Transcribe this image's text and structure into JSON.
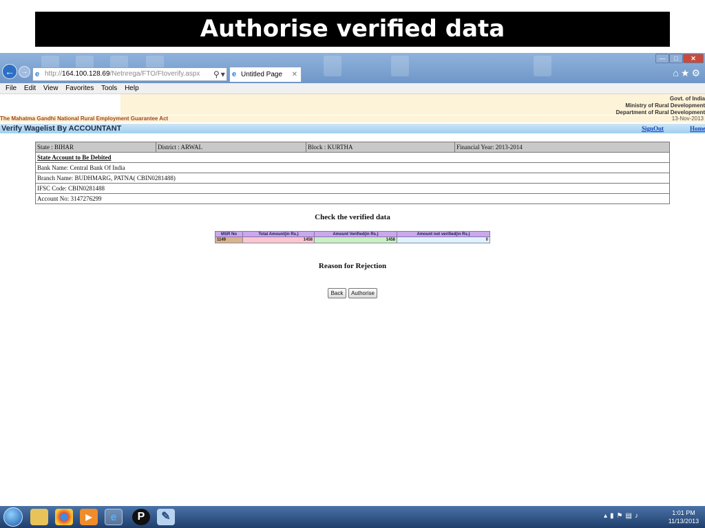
{
  "slide": {
    "title": "Authorise verified data"
  },
  "browser": {
    "url_protocol": "http://",
    "url_host": "164.100.128.69",
    "url_path": "/Netnrega/FTO/Ftoverify.aspx",
    "tab_title": "Untitled Page",
    "menu": [
      "File",
      "Edit",
      "View",
      "Favorites",
      "Tools",
      "Help"
    ]
  },
  "header": {
    "govt_line1": "Govt. of India",
    "govt_line2": "Ministry of Rural Development",
    "govt_line3": "Department of Rural Development",
    "act": "The Mahatma Gandhi National Rural Employment Guarantee Act",
    "date": "13-Nov-2013",
    "page_heading": "Verify Wagelist By ACCOUNTANT",
    "signout": "SignOut",
    "home": "Home"
  },
  "account": {
    "state": "State : BIHAR",
    "district": "District : ARWAL",
    "block": "Block : KURTHA",
    "financial_year": "Financial Year: 2013-2014",
    "section_heading": "State Account to Be Debited",
    "bank_name": "Bank Name: Central Bank Of India",
    "branch_name": "Branch Name: BUDHMARG, PATNA( CBIN0281488)",
    "ifsc": "IFSC Code: CBIN0281488",
    "account_no": "Account No: 3147276299"
  },
  "check": {
    "title": "Check the verified data",
    "headers": [
      "MSR No",
      "Total Amount(in Rs.)",
      "Amount Verified(in Rs.)",
      "Amount not verified(in Rs.)"
    ],
    "row": [
      "1149",
      "1458",
      "1458",
      "0"
    ]
  },
  "rejection": {
    "title": "Reason for Rejection"
  },
  "buttons": {
    "back": "Back",
    "authorise": "Authorise"
  },
  "taskbar": {
    "time": "1:01 PM",
    "date": "11/13/2013"
  },
  "colors": {
    "title_bg": "#000000",
    "table_header": "#c9a8ec",
    "msr_cell": "#d9b38c",
    "total_cell": "#f9c7cd",
    "verified_cell": "#c8f0c0",
    "not_verified_cell": "#dff2fb"
  }
}
